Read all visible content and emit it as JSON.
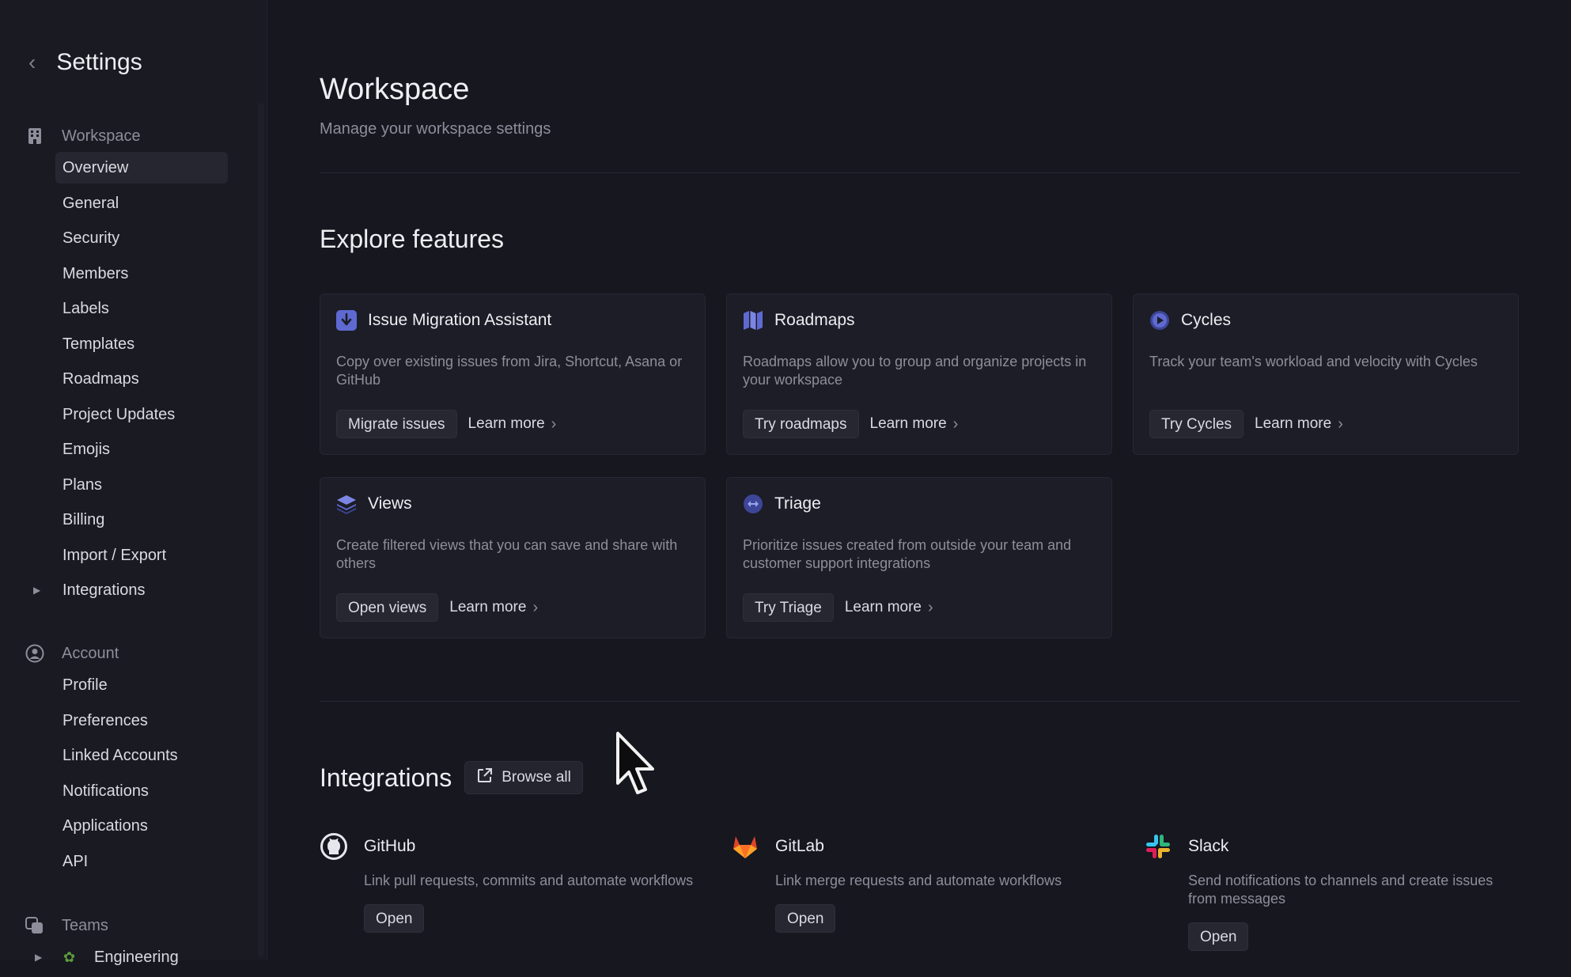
{
  "sidebar": {
    "title": "Settings",
    "workspace": {
      "label": "Workspace",
      "items": [
        "Overview",
        "General",
        "Security",
        "Members",
        "Labels",
        "Templates",
        "Roadmaps",
        "Project Updates",
        "Emojis",
        "Plans",
        "Billing",
        "Import / Export",
        "Integrations"
      ]
    },
    "account": {
      "label": "Account",
      "items": [
        "Profile",
        "Preferences",
        "Linked Accounts",
        "Notifications",
        "Applications",
        "API"
      ]
    },
    "teams": {
      "label": "Teams",
      "items": [
        "Engineering"
      ]
    }
  },
  "header": {
    "title": "Workspace",
    "subtitle": "Manage your workspace settings"
  },
  "features": {
    "title": "Explore features",
    "cards": [
      {
        "title": "Issue Migration Assistant",
        "desc": "Copy over existing issues from Jira, Shortcut, Asana or GitHub",
        "button": "Migrate issues",
        "link": "Learn more",
        "icon": "download-arrow-icon"
      },
      {
        "title": "Roadmaps",
        "desc": "Roadmaps allow you to group and organize projects in your workspace",
        "button": "Try roadmaps",
        "link": "Learn more",
        "icon": "map-icon"
      },
      {
        "title": "Cycles",
        "desc": "Track your team's workload and velocity with Cycles",
        "button": "Try Cycles",
        "link": "Learn more",
        "icon": "cycle-icon"
      },
      {
        "title": "Views",
        "desc": "Create filtered views that you can save and share with others",
        "button": "Open views",
        "link": "Learn more",
        "icon": "layers-icon"
      },
      {
        "title": "Triage",
        "desc": "Prioritize issues created from outside your team and customer support integrations",
        "button": "Try Triage",
        "link": "Learn more",
        "icon": "triage-icon"
      }
    ]
  },
  "integrations": {
    "title": "Integrations",
    "browse_label": "Browse all",
    "items": [
      {
        "name": "GitHub",
        "desc": "Link pull requests, commits and automate workflows",
        "button": "Open"
      },
      {
        "name": "GitLab",
        "desc": "Link merge requests and automate workflows",
        "button": "Open"
      },
      {
        "name": "Slack",
        "desc": "Send notifications to channels and create issues from messages",
        "button": "Open"
      }
    ]
  },
  "colors": {
    "background": "#16171f",
    "sidebar": "#191a22",
    "card": "#1c1d26",
    "accent": "#5e6ad2",
    "gitlab": "#e24329"
  }
}
